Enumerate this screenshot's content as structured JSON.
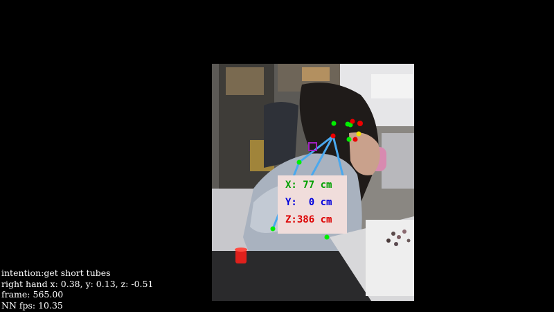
{
  "window": {
    "background": "#000000"
  },
  "camera_view": {
    "scene": "person-reaching-across-lab-table"
  },
  "pose_overlay": {
    "skeleton_color": "#4aa8ee",
    "joint_green": "#00ee00",
    "joint_red": "#ee0000",
    "joint_yellow": "#f0e000",
    "target_marker_color": "#a020c0"
  },
  "coordinates_panel": {
    "background": "#f0dddb",
    "x_text": "X: 77 cm",
    "x_color": "#00a000",
    "y_text": "Y:  0 cm",
    "y_color": "#0000dd",
    "z_text": "Z:386 cm",
    "z_color": "#dd0000"
  },
  "hud": {
    "intention": "intention:get short tubes",
    "right_hand": "right hand x: 0.38, y: 0.13, z: -0.51",
    "frame": "frame: 565.00",
    "fps": "NN fps: 10.35"
  }
}
